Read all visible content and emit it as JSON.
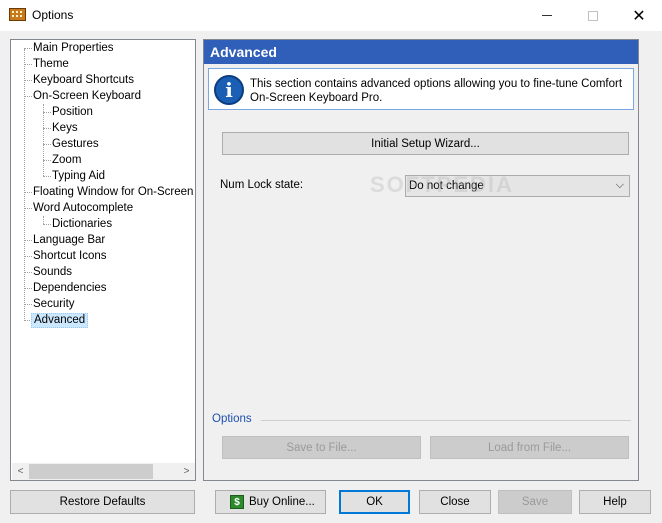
{
  "window": {
    "title": "Options",
    "min_icon": "minimize-icon",
    "max_icon": "maximize-icon",
    "close_icon": "close-icon",
    "close_glyph": "✕"
  },
  "tree": {
    "items": [
      {
        "label": "Main Properties",
        "level": 0
      },
      {
        "label": "Theme",
        "level": 0
      },
      {
        "label": "Keyboard Shortcuts",
        "level": 0
      },
      {
        "label": "On-Screen Keyboard",
        "level": 0
      },
      {
        "label": "Position",
        "level": 1
      },
      {
        "label": "Keys",
        "level": 1
      },
      {
        "label": "Gestures",
        "level": 1
      },
      {
        "label": "Zoom",
        "level": 1
      },
      {
        "label": "Typing Aid",
        "level": 1
      },
      {
        "label": "Floating Window for On-Screen Ke",
        "level": 0
      },
      {
        "label": "Word Autocomplete",
        "level": 0
      },
      {
        "label": "Dictionaries",
        "level": 1
      },
      {
        "label": "Language Bar",
        "level": 0
      },
      {
        "label": "Shortcut Icons",
        "level": 0
      },
      {
        "label": "Sounds",
        "level": 0
      },
      {
        "label": "Dependencies",
        "level": 0
      },
      {
        "label": "Security",
        "level": 0
      },
      {
        "label": "Advanced",
        "level": 0,
        "selected": true
      }
    ],
    "scroll_left": "<",
    "scroll_right": ">"
  },
  "main": {
    "header": "Advanced",
    "info_icon": "info-icon",
    "info_glyph": "i",
    "info_text": "This section contains advanced options allowing you to fine-tune Comfort On-Screen Keyboard Pro.",
    "setup_wizard_label": "Initial Setup Wizard...",
    "numlock_label": "Num Lock state:",
    "numlock_value": "Do not change",
    "numlock_chevron": "⌵",
    "options_group_label": "Options",
    "save_to_file_label": "Save to File...",
    "load_from_file_label": "Load from File..."
  },
  "watermark": "SOFTPEDIA",
  "footer": {
    "restore_defaults": "Restore Defaults",
    "buy_online": "Buy Online...",
    "buy_icon": "dollar-icon",
    "buy_icon_glyph": "$",
    "ok": "OK",
    "close": "Close",
    "save": "Save",
    "help": "Help"
  },
  "colors": {
    "header_bg": "#2f5fb8",
    "selection_bg": "#cce8ff",
    "group_label": "#1e4fb0",
    "default_button_border": "#0078d7"
  }
}
